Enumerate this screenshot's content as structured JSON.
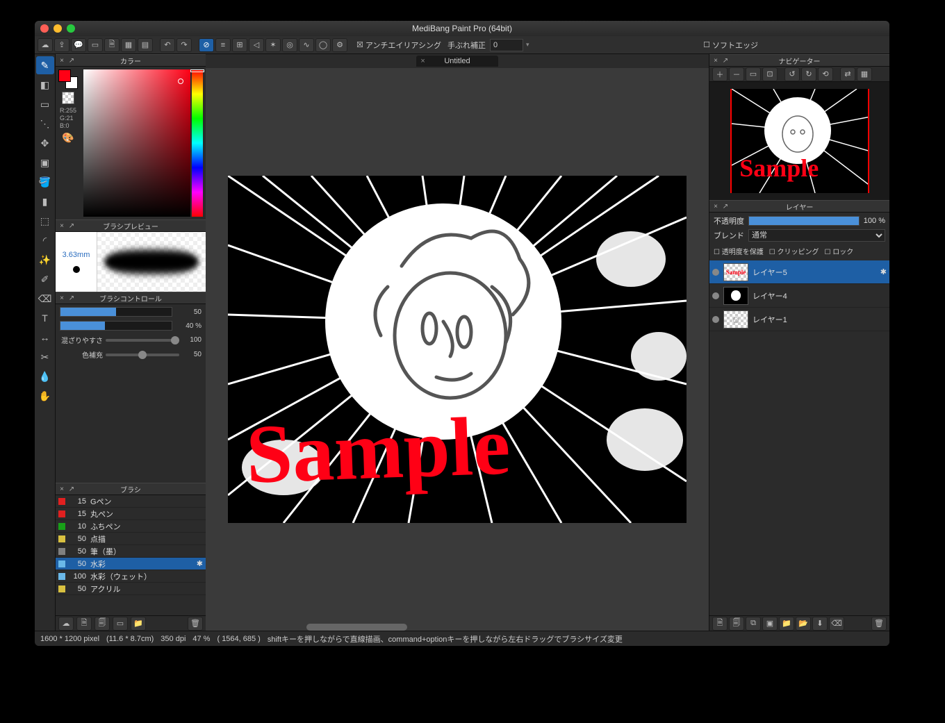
{
  "app": {
    "title": "MediBang Paint Pro (64bit)"
  },
  "toolbar": {
    "antialias_label": "アンチエイリアシング",
    "stabilizer_label": "手ぶれ補正",
    "stabilizer_value": "0",
    "softedge_label": "ソフトエッジ"
  },
  "document": {
    "tab_title": "Untitled"
  },
  "panels": {
    "color_title": "カラー",
    "brush_preview_title": "ブラシプレビュー",
    "brush_control_title": "ブラシコントロール",
    "brush_title": "ブラシ",
    "navigator_title": "ナビゲーター",
    "layer_title": "レイヤー"
  },
  "color": {
    "r_label": "R:255",
    "g_label": "G:21",
    "b_label": "B:0",
    "fg_hex": "#ff0015",
    "bg_hex": "#ffffff"
  },
  "brush_preview": {
    "size_label": "3.63mm"
  },
  "brush_control": {
    "size_value": "50",
    "opacity_value": "40 %",
    "mix_label": "混ざりやすさ",
    "mix_value": "100",
    "load_label": "色補充",
    "load_value": "50"
  },
  "brushes": [
    {
      "color": "#e02020",
      "size": "15",
      "name": "Gペン"
    },
    {
      "color": "#e02020",
      "size": "15",
      "name": "丸ペン"
    },
    {
      "color": "#18a018",
      "size": "10",
      "name": "ふちペン"
    },
    {
      "color": "#d8c040",
      "size": "50",
      "name": "点描"
    },
    {
      "color": "#808080",
      "size": "50",
      "name": "筆（墨）"
    },
    {
      "color": "#6ab8e8",
      "size": "50",
      "name": "水彩",
      "selected": true
    },
    {
      "color": "#6ab8e8",
      "size": "100",
      "name": "水彩（ウェット）"
    },
    {
      "color": "#d8c040",
      "size": "50",
      "name": "アクリル"
    }
  ],
  "layer_panel": {
    "opacity_label": "不透明度",
    "opacity_value": "100 %",
    "blend_label": "ブレンド",
    "blend_value": "通常",
    "protect_alpha": "透明度を保護",
    "clipping": "クリッピング",
    "lock": "ロック"
  },
  "layers": [
    {
      "name": "レイヤー5",
      "selected": true,
      "thumb": "sample"
    },
    {
      "name": "レイヤー4",
      "thumb": "burst"
    },
    {
      "name": "レイヤー1",
      "thumb": "face"
    }
  ],
  "status": {
    "dims": "1600 * 1200 pixel",
    "cm": "(11.6 * 8.7cm)",
    "dpi": "350 dpi",
    "zoom": "47 %",
    "coords": "( 1564, 685 )",
    "hint": "shiftキーを押しながらで直線描画、command+optionキーを押しながら左右ドラッグでブラシサイズ変更"
  }
}
